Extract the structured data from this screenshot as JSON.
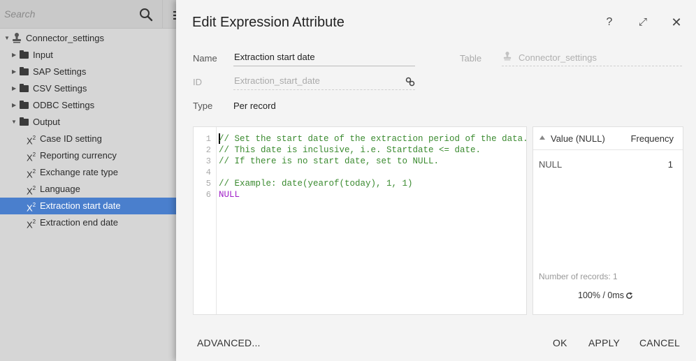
{
  "sidebar": {
    "search_placeholder": "Search",
    "tree": {
      "root": "Connector_settings",
      "folders": [
        "Input",
        "SAP Settings",
        "CSV Settings",
        "ODBC Settings",
        "Output"
      ],
      "output_items": [
        "Case ID setting",
        "Reporting currency",
        "Exchange rate type",
        "Language",
        "Extraction start date",
        "Extraction end date"
      ],
      "selected": "Extraction start date"
    },
    "expression_icon_text": "X",
    "expression_icon_sup": "2"
  },
  "dialog": {
    "title": "Edit Expression Attribute",
    "header_buttons": {
      "help": "?",
      "expand": "⤢",
      "close": "✕"
    },
    "fields": {
      "name_label": "Name",
      "name_value": "Extraction start date",
      "table_label": "Table",
      "table_value": "Connector_settings",
      "id_label": "ID",
      "id_value": "Extraction_start_date",
      "type_label": "Type",
      "type_value": "Per record"
    },
    "editor": {
      "line_numbers": [
        "1",
        "2",
        "3",
        "4",
        "5",
        "6"
      ],
      "lines": [
        "// Set the start date of the extraction period of the data.",
        "// This date is inclusive, i.e. Startdate <= date.",
        "// If there is no start date, set to NULL.",
        "",
        "// Example: date(yearof(today), 1, 1)",
        "NULL"
      ],
      "colors": {
        "comment": "#3a8a2f",
        "keyword": "#a020c8"
      }
    },
    "preview": {
      "columns": [
        "Value (NULL)",
        "Frequency"
      ],
      "rows": [
        {
          "value": "NULL",
          "frequency": "1"
        }
      ],
      "record_count_text": "Number of records: 1",
      "stats_text": "100% / 0ms"
    },
    "footer": {
      "advanced": "ADVANCED...",
      "ok": "OK",
      "apply": "APPLY",
      "cancel": "CANCEL"
    }
  },
  "colors": {
    "selection": "#4a7fcd",
    "dialog_bg": "#f4f4f4",
    "panel_bg": "#d6d6d6"
  }
}
